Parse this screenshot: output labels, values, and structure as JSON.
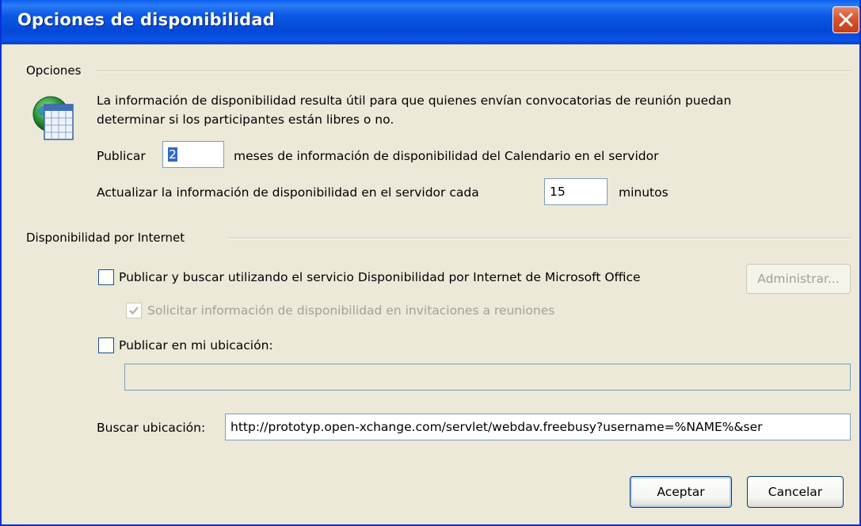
{
  "window": {
    "title": "Opciones de disponibilidad"
  },
  "options_group": {
    "label": "Opciones",
    "description_line1": "La información de disponibilidad resulta útil para que quienes envían convocatorias de reunión puedan",
    "description_line2": "determinar si los participantes están libres o no.",
    "publish_label": "Publicar",
    "publish_months_value": "2",
    "publish_suffix": "meses de información de disponibilidad del Calendario en el servidor",
    "update_label": "Actualizar la información de disponibilidad en el servidor cada",
    "update_minutes_value": "15",
    "update_suffix": "minutos"
  },
  "internet_group": {
    "label": "Disponibilidad por Internet",
    "ms_service_label": "Publicar y buscar utilizando el servicio Disponibilidad por Internet de Microsoft Office",
    "ms_service_checked": false,
    "manage_button": "Administrar...",
    "request_info_label": "Solicitar información de disponibilidad en invitaciones a reuniones",
    "request_info_checked": true,
    "publish_location_label": "Publicar en mi ubicación:",
    "publish_location_checked": false,
    "publish_location_value": "",
    "search_location_label": "Buscar ubicación:",
    "search_location_value": "http://prototyp.open-xchange.com/servlet/webdav.freebusy?username=%NAME%&ser"
  },
  "buttons": {
    "ok": "Aceptar",
    "cancel": "Cancelar"
  },
  "colors": {
    "titlebar": "#0a58e4",
    "dialog_bg": "#ece9d8",
    "close_button": "#d6542d",
    "selection": "#316ac5"
  }
}
